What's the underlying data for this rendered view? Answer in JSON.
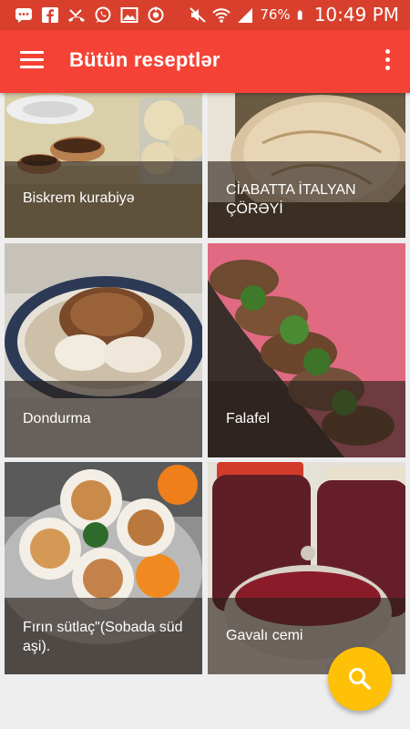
{
  "status_bar": {
    "battery_percent": "76%",
    "time": "10:49 PM",
    "icons": [
      "messages-icon",
      "facebook-icon",
      "missed-call-icon",
      "whatsapp-icon",
      "gallery-icon",
      "camera-app-icon",
      "mute-icon",
      "wifi-icon",
      "signal-icon",
      "battery-icon"
    ]
  },
  "app_bar": {
    "title": "Bütün reseptlər",
    "menu_icon": "hamburger-menu-icon",
    "overflow_icon": "more-vert-icon"
  },
  "recipes": [
    {
      "name": "Biskrem kurabiyə"
    },
    {
      "name": "CİABATTA İTALYAN ÇÖRƏYİ"
    },
    {
      "name": "Dondurma"
    },
    {
      "name": "Falafel"
    },
    {
      "name": "Fırın sütlaç\"(Sobada süd aşi)."
    },
    {
      "name": "Gavalı cemi"
    }
  ],
  "fab": {
    "icon": "search-icon"
  },
  "colors": {
    "status_bar": "#d8402d",
    "app_bar": "#f44336",
    "fab": "#ffc107",
    "background": "#eeeeee"
  }
}
